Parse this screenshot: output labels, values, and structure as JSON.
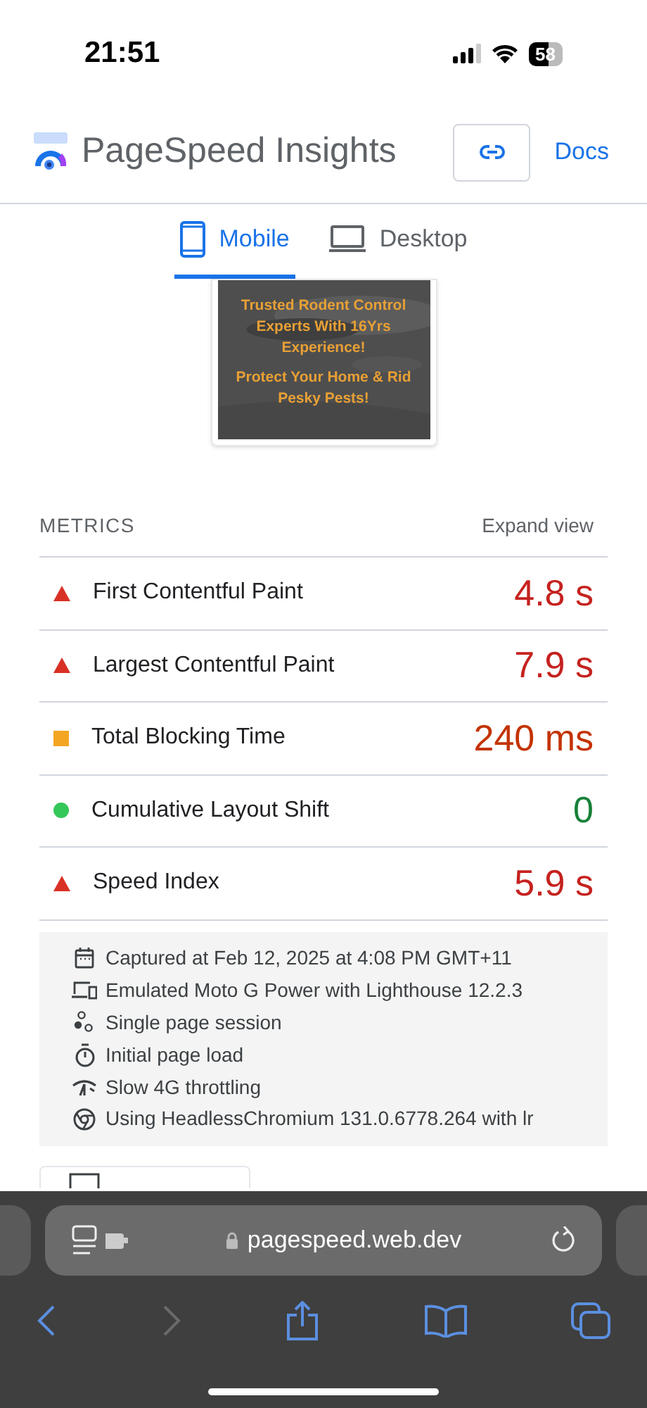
{
  "status_bar": {
    "time": "21:51",
    "battery": "58"
  },
  "header": {
    "title": "PageSpeed Insights",
    "docs": "Docs"
  },
  "tabs": [
    {
      "label": "Mobile",
      "kind": "mobile",
      "selected": true
    },
    {
      "label": "Desktop",
      "kind": "desktop",
      "selected": false
    }
  ],
  "screenshot": {
    "lines": [
      "Trusted Rodent Control Experts With 16Yrs Experience!",
      "Protect Your Home & Rid Pesky Pests!"
    ]
  },
  "metrics": {
    "heading": "METRICS",
    "expand": "Expand view",
    "items": [
      {
        "name": "First Contentful Paint",
        "value": "4.8 s",
        "kind": "fail"
      },
      {
        "name": "Largest Contentful Paint",
        "value": "7.9 s",
        "kind": "fail"
      },
      {
        "name": "Total Blocking Time",
        "value": "240 ms",
        "kind": "average"
      },
      {
        "name": "Cumulative Layout Shift",
        "value": "0",
        "kind": "pass"
      },
      {
        "name": "Speed Index",
        "value": "5.9 s",
        "kind": "fail"
      }
    ]
  },
  "environment": [
    {
      "kind": "calendar",
      "text": "Captured at Feb 12, 2025 at 4:08 PM GMT+11"
    },
    {
      "kind": "devices",
      "text": "Emulated Moto G Power with Lighthouse 12.2.3"
    },
    {
      "kind": "session",
      "text": "Single page session"
    },
    {
      "kind": "timer",
      "text": "Initial page load"
    },
    {
      "kind": "network",
      "text": "Slow 4G throttling"
    },
    {
      "kind": "browser",
      "text": "Using HeadlessChromium 131.0.6778.264 with lr"
    }
  ],
  "browser": {
    "url": "pagespeed.web.dev"
  }
}
